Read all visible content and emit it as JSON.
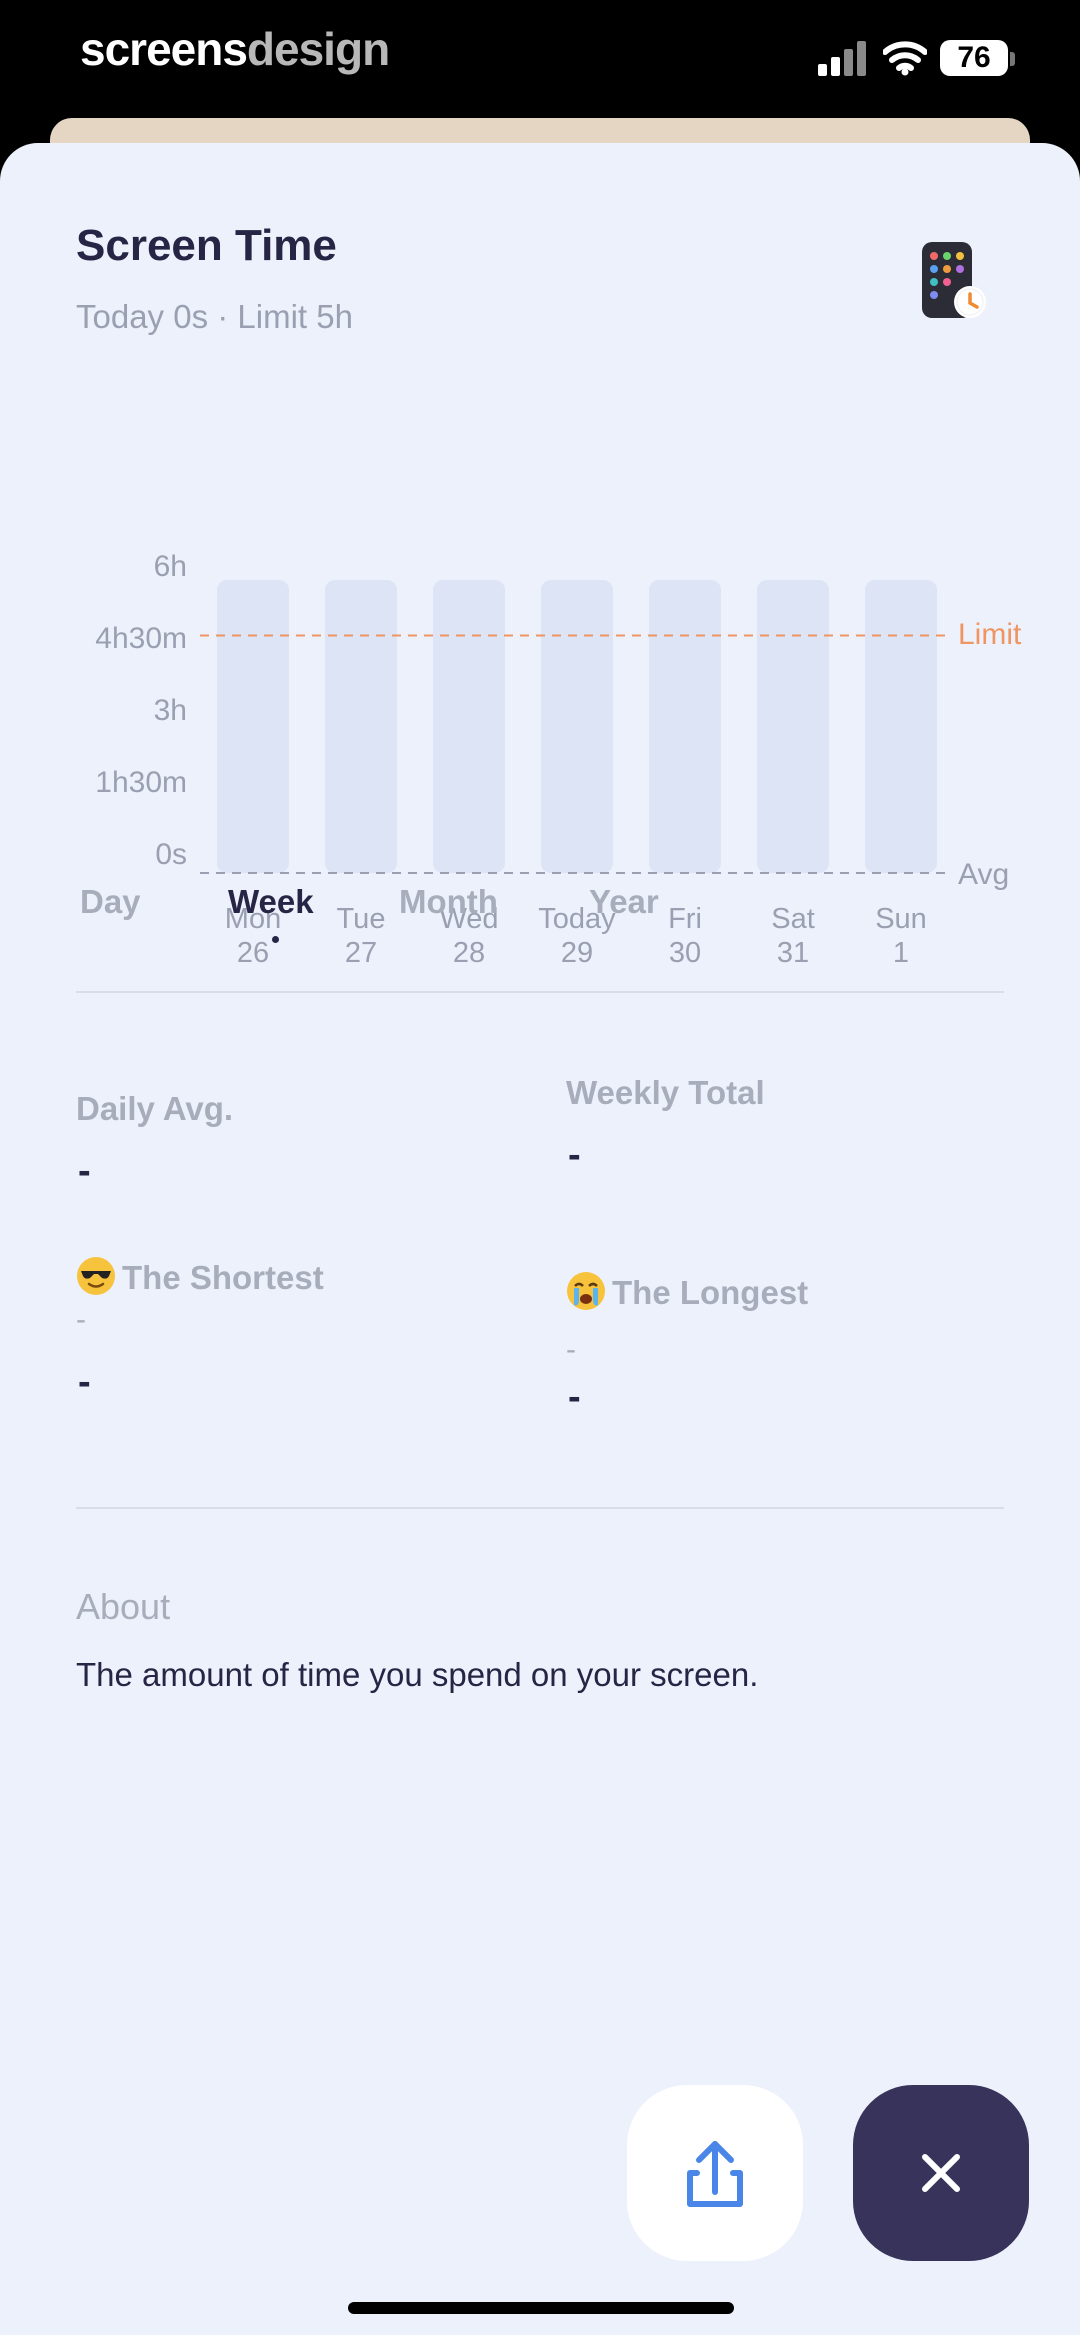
{
  "status_bar": {
    "brand_part1": "screens",
    "brand_part2": "design",
    "battery": "76"
  },
  "header": {
    "title": "Screen Time",
    "subtitle": "Today 0s · Limit 5h",
    "icon": "phone-clock-icon"
  },
  "chart_data": {
    "type": "bar",
    "categories": [
      "Mon 26",
      "Tue 27",
      "Wed 28",
      "Today 29",
      "Fri 30",
      "Sat 31",
      "Sun 1"
    ],
    "x_labels": [
      {
        "day": "Mon",
        "date": "26"
      },
      {
        "day": "Tue",
        "date": "27"
      },
      {
        "day": "Wed",
        "date": "28"
      },
      {
        "day": "Today",
        "date": "29"
      },
      {
        "day": "Fri",
        "date": "30"
      },
      {
        "day": "Sat",
        "date": "31"
      },
      {
        "day": "Sun",
        "date": "1"
      }
    ],
    "values": [
      0,
      0,
      0,
      0,
      0,
      0,
      0
    ],
    "y_ticks": [
      "6h",
      "4h30m",
      "3h",
      "1h30m",
      "0s"
    ],
    "y_tick_minutes": [
      360,
      270,
      180,
      90,
      0
    ],
    "ylim_minutes": [
      0,
      360
    ],
    "limit_minutes": 300,
    "limit_label": "Limit",
    "avg_minutes": 0,
    "avg_label": "Avg",
    "colors": {
      "bar_track": "#dce4f5",
      "limit": "#ee9563",
      "axis": "#9aa0b1"
    }
  },
  "tabs": [
    {
      "label": "Day",
      "active": false
    },
    {
      "label": "Week",
      "active": true
    },
    {
      "label": "Month",
      "active": false
    },
    {
      "label": "Year",
      "active": false
    }
  ],
  "stats": {
    "daily_avg_label": "Daily Avg.",
    "daily_avg_value": "-",
    "weekly_total_label": "Weekly Total",
    "weekly_total_value": "-",
    "shortest_label": "The Shortest",
    "shortest_emoji": "sunglasses-emoji",
    "shortest_sub": "-",
    "shortest_value": "-",
    "longest_label": "The Longest",
    "longest_emoji": "crying-emoji",
    "longest_sub": "-",
    "longest_value": "-"
  },
  "about": {
    "title": "About",
    "text": "The amount of time you spend on your screen."
  },
  "actions": {
    "share_icon": "share-icon",
    "close_icon": "close-icon"
  },
  "colors": {
    "background": "#edf1fb",
    "text_primary": "#262545",
    "text_muted": "#a8adbc",
    "accent_dark": "#37335a",
    "limit": "#ee9563"
  }
}
